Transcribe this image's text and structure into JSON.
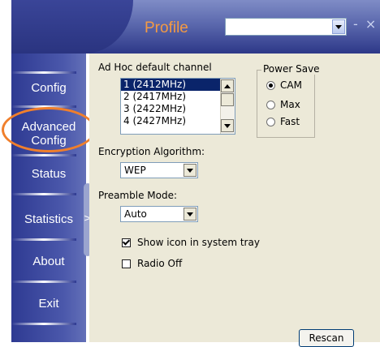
{
  "header": {
    "title": "Profile",
    "profile_select_value": "",
    "window_buttons": "- ×"
  },
  "sidebar": {
    "items": [
      {
        "label": "Config"
      },
      {
        "label": "Advanced"
      },
      {
        "label": "Config"
      },
      {
        "label": "Status"
      },
      {
        "label": "Statistics"
      },
      {
        "label": "About"
      },
      {
        "label": "Exit"
      }
    ],
    "expand_arrow": ">"
  },
  "adhoc": {
    "label": "Ad Hoc default channel",
    "channels": [
      "1 (2412MHz)",
      "2 (2417MHz)",
      "3 (2422MHz)",
      "4 (2427MHz)"
    ],
    "selected": "1 (2412MHz)"
  },
  "power_save": {
    "title": "Power Save",
    "options": [
      "CAM",
      "Max",
      "Fast"
    ],
    "selected": "CAM"
  },
  "encryption": {
    "label": "Encryption Algorithm:",
    "value": "WEP"
  },
  "preamble": {
    "label": "Preamble Mode:",
    "value": "Auto"
  },
  "checkboxes": {
    "show_icon": {
      "label": "Show icon in system tray",
      "checked": true
    },
    "radio_off": {
      "label": "Radio Off",
      "checked": false
    }
  },
  "rescan_label": "Rescan",
  "colors": {
    "accent": "#f49a43",
    "sidebar": "#3a4598",
    "highlight_ring": "#f07f2c",
    "panel": "#ece9d8"
  }
}
